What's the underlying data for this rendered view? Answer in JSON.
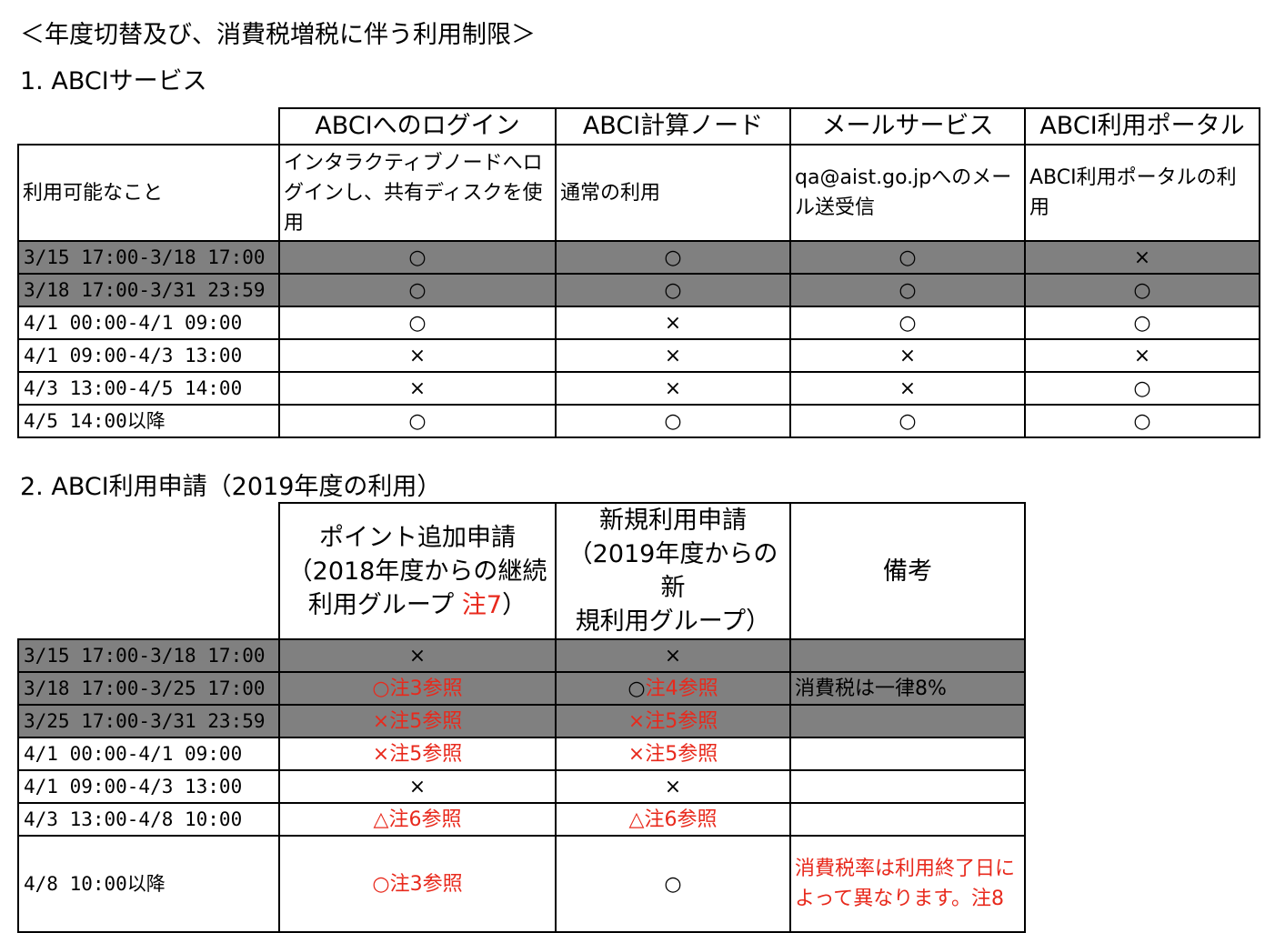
{
  "title": "＜年度切替及び、消費税増税に伴う利用制限＞",
  "section1": {
    "heading": "1. ABCIサービス",
    "columns": [
      "ABCIへのログイン",
      "ABCI計算ノード",
      "メールサービス",
      "ABCI利用ポータル"
    ],
    "desc_row": {
      "label": "利用可能なこと",
      "cells": [
        "インタラクティブノードへログインし、共有ディスクを使用",
        "通常の利用",
        "qa@aist.go.jpへのメール送受信",
        "ABCI利用ポータルの利用"
      ]
    },
    "rows": [
      {
        "period": "3/15 17:00-3/18 17:00",
        "cells": [
          "○",
          "○",
          "○",
          "×"
        ],
        "shaded": true
      },
      {
        "period": "3/18 17:00-3/31 23:59",
        "cells": [
          "○",
          "○",
          "○",
          "○"
        ],
        "shaded": true
      },
      {
        "period": "4/1 00:00-4/1 09:00",
        "cells": [
          "○",
          "×",
          "○",
          "○"
        ],
        "shaded": false
      },
      {
        "period": "4/1 09:00-4/3 13:00",
        "cells": [
          "×",
          "×",
          "×",
          "×"
        ],
        "shaded": false
      },
      {
        "period": "4/3 13:00-4/5 14:00",
        "cells": [
          "×",
          "×",
          "×",
          "○"
        ],
        "shaded": false
      },
      {
        "period": "4/5 14:00以降",
        "cells": [
          "○",
          "○",
          "○",
          "○"
        ],
        "shaded": false
      }
    ]
  },
  "section2": {
    "heading": "2. ABCI利用申請（2019年度の利用）",
    "col1_line1": "ポイント追加申請",
    "col1_line2": "（2018年度からの継続",
    "col1_line3": "利用グループ ",
    "col1_note": "注7",
    "col1_line3_end": "）",
    "col2_line1": "新規利用申請",
    "col2_line2": "（2019年度からの新",
    "col2_line3": "規利用グループ）",
    "col3": "備考",
    "rows": [
      {
        "period": "3/15 17:00-3/18 17:00",
        "c1": "×",
        "c1_note": "",
        "c2": "×",
        "c2_note": "",
        "remark": "",
        "shaded": true
      },
      {
        "period": "3/18 17:00-3/25 17:00",
        "c1": "○",
        "c1_note": "注3参照",
        "c2": "○",
        "c2_note": "注4参照",
        "remark": "消費税は一律8%",
        "shaded": true
      },
      {
        "period": "3/25 17:00-3/31 23:59",
        "c1": "×",
        "c1_note": "注5参照",
        "c2": "×",
        "c2_note": "注5参照",
        "remark": "",
        "shaded": true
      },
      {
        "period": "4/1 00:00-4/1 09:00",
        "c1": "×",
        "c1_note": "注5参照",
        "c2": "×",
        "c2_note": "注5参照",
        "remark": "",
        "shaded": false
      },
      {
        "period": "4/1 09:00-4/3 13:00",
        "c1": "×",
        "c1_note": "",
        "c2": "×",
        "c2_note": "",
        "remark": "",
        "shaded": false
      },
      {
        "period": "4/3 13:00-4/8 10:00",
        "c1": "△",
        "c1_note": "注6参照",
        "c2": "△",
        "c2_note": "注6参照",
        "remark": "",
        "shaded": false
      },
      {
        "period": "4/8 10:00以降",
        "c1": "○",
        "c1_note": "注3参照",
        "c2": "○",
        "c2_note": "",
        "remark": "消費税率は利用終了日によって異なります。注8",
        "shaded": false
      }
    ]
  },
  "colors": {
    "shade": "#808080",
    "note_red": "#e8291c",
    "border": "#000000"
  }
}
